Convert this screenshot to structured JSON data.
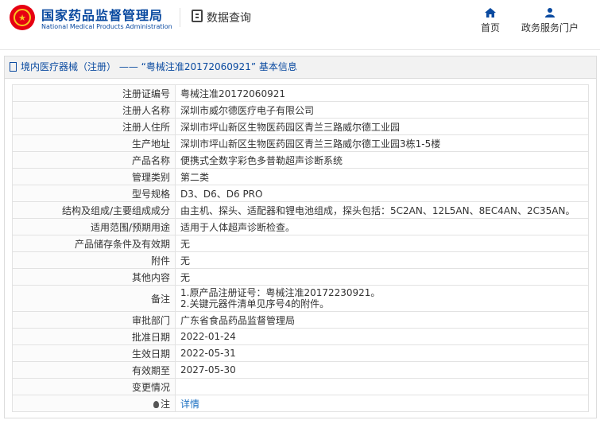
{
  "header": {
    "site_title": "国家药品监督管理局",
    "site_subtitle": "National Medical Products Administration",
    "query_title": "数据查询",
    "nav": [
      {
        "label": "首页",
        "icon": "home-icon"
      },
      {
        "label": "政务服务门户",
        "icon": "user-icon"
      }
    ],
    "brand_color": "#0a4aa0",
    "logo_color": "#e60012"
  },
  "panel": {
    "title": "境内医疗器械（注册） —— “粤械注准20172060921” 基本信息"
  },
  "rows": [
    {
      "label": "注册证编号",
      "value": "粤械注准20172060921"
    },
    {
      "label": "注册人名称",
      "value": "深圳市威尔德医疗电子有限公司"
    },
    {
      "label": "注册人住所",
      "value": "深圳市坪山新区生物医药园区青兰三路威尔德工业园"
    },
    {
      "label": "生产地址",
      "value": "深圳市坪山新区生物医药园区青兰三路威尔德工业园3栋1-5楼"
    },
    {
      "label": "产品名称",
      "value": "便携式全数字彩色多普勒超声诊断系统"
    },
    {
      "label": "管理类别",
      "value": "第二类"
    },
    {
      "label": "型号规格",
      "value": "D3、D6、D6 PRO"
    },
    {
      "label": "结构及组成/主要组成成分",
      "value": "由主机、探头、适配器和锂电池组成，探头包括：5C2AN、12L5AN、8EC4AN、2C35AN。"
    },
    {
      "label": "适用范围/预期用途",
      "value": "适用于人体超声诊断检查。"
    },
    {
      "label": "产品储存条件及有效期",
      "value": "无"
    },
    {
      "label": "附件",
      "value": "无"
    },
    {
      "label": "其他内容",
      "value": "无"
    }
  ],
  "remarks": {
    "label": "备注",
    "line1": "1.原产品注册证号：粤械注准20172230921。",
    "line2": "2.关键元器件清单见序号4的附件。"
  },
  "rows2": [
    {
      "label": "审批部门",
      "value": "广东省食品药品监督管理局"
    },
    {
      "label": "批准日期",
      "value": "2022-01-24"
    },
    {
      "label": "生效日期",
      "value": "2022-05-31"
    },
    {
      "label": "有效期至",
      "value": "2027-05-30"
    },
    {
      "label": "变更情况",
      "value": ""
    }
  ],
  "note": {
    "label": "注",
    "icon": "lightbulb-icon",
    "link_text": "详情"
  }
}
